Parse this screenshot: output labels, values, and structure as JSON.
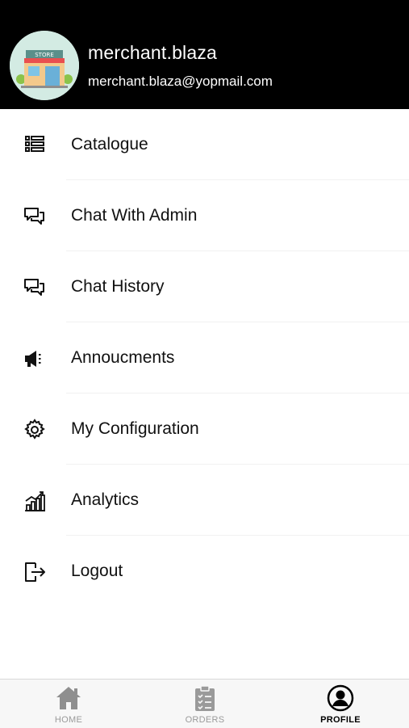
{
  "profile": {
    "name": "merchant.blaza",
    "email": "merchant.blaza@yopmail.com",
    "avatar_sign": "STORE"
  },
  "menu": {
    "items": [
      {
        "label": "Catalogue",
        "icon": "list-icon"
      },
      {
        "label": "Chat With Admin",
        "icon": "chat-icon"
      },
      {
        "label": "Chat History",
        "icon": "chat-icon"
      },
      {
        "label": "Annoucments",
        "icon": "megaphone-icon"
      },
      {
        "label": "My Configuration",
        "icon": "gear-icon"
      },
      {
        "label": "Analytics",
        "icon": "chart-icon"
      },
      {
        "label": "Logout",
        "icon": "logout-icon"
      }
    ]
  },
  "tabbar": {
    "home_label": "HOME",
    "orders_label": "ORDERS",
    "profile_label": "PROFILE",
    "active": "PROFILE"
  },
  "colors": {
    "header_bg": "#000000",
    "active_tab": "#000000",
    "inactive_tab": "#9a9a9a"
  }
}
